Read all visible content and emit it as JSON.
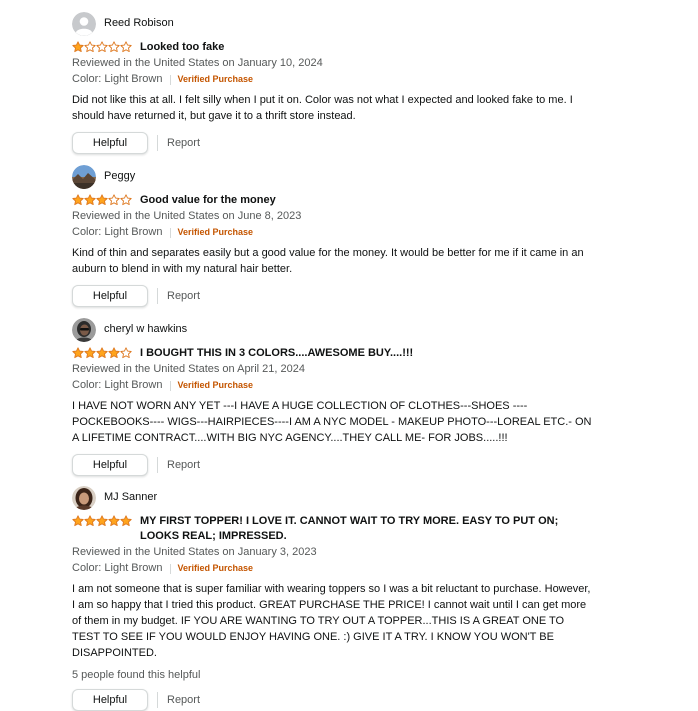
{
  "reviews": [
    {
      "author": "Reed Robison",
      "avatar_type": "default-person-icon",
      "rating": 1,
      "title": "Looked too fake",
      "meta": "Reviewed in the United States on January 10, 2024",
      "color": "Color: Light Brown",
      "verified": "Verified Purchase",
      "body": "Did not like this at all. I felt silly when I put it on. Color was not what I expected and looked fake to me. I should have returned it, but gave it to a thrift store instead.",
      "helpful_count": "",
      "helpful_label": "Helpful",
      "report_label": "Report"
    },
    {
      "author": "Peggy",
      "avatar_type": "landscape-photo",
      "rating": 3,
      "title": "Good value for the money",
      "meta": "Reviewed in the United States on June 8, 2023",
      "color": "Color: Light Brown",
      "verified": "Verified Purchase",
      "body": "Kind of thin and separates easily but a good value for the money. It would be better for me if it came in an auburn to blend in with my natural hair better.",
      "helpful_count": "",
      "helpful_label": "Helpful",
      "report_label": "Report"
    },
    {
      "author": "cheryl w hawkins",
      "avatar_type": "portrait-photo",
      "rating": 4,
      "title": "I BOUGHT THIS IN 3 COLORS....AWESOME BUY....!!!",
      "meta": "Reviewed in the United States on April 21, 2024",
      "color": "Color: Light Brown",
      "verified": "Verified Purchase",
      "body": "I HAVE NOT WORN ANY YET ---I HAVE A HUGE COLLECTION OF CLOTHES---SHOES ----POCKEBOOKS---- WIGS---HAIRPIECES----I AM A NYC MODEL - MAKEUP PHOTO---LOREAL ETC.- ON A LIFETIME CONTRACT....WITH BIG NYC AGENCY....THEY CALL ME- FOR JOBS.....!!!",
      "helpful_count": "",
      "helpful_label": "Helpful",
      "report_label": "Report"
    },
    {
      "author": "MJ Sanner",
      "avatar_type": "portrait-photo",
      "rating": 5,
      "title": "MY FIRST TOPPER! I LOVE IT. CANNOT WAIT TO TRY MORE. EASY TO PUT ON; LOOKS REAL; IMPRESSED.",
      "meta": "Reviewed in the United States on January 3, 2023",
      "color": "Color: Light Brown",
      "verified": "Verified Purchase",
      "body": "I am not someone that is super familiar with wearing toppers so I was a bit reluctant to purchase. However, I am so happy that I tried this product. GREAT PURCHASE THE PRICE! I cannot wait until I can get more of them in my budget. IF YOU ARE WANTING TO TRY OUT A TOPPER...THIS IS A GREAT ONE TO TEST TO SEE IF YOU WOULD ENJOY HAVING ONE. :) GIVE IT A TRY. I KNOW YOU WON'T BE DISAPPOINTED.",
      "helpful_count": "5 people found this helpful",
      "helpful_label": "Helpful",
      "report_label": "Report"
    }
  ],
  "colors": {
    "star_fill": "#ffa41c",
    "star_outline": "#de7921",
    "verified": "#c45500",
    "meta": "#565959"
  }
}
